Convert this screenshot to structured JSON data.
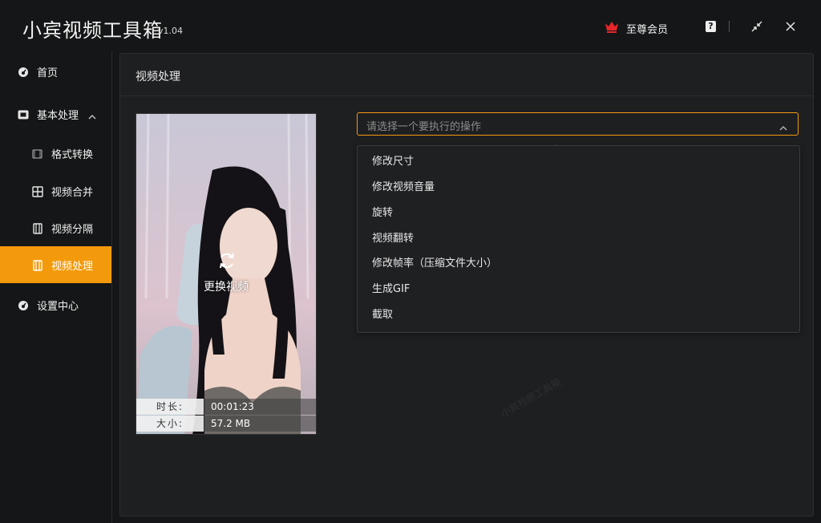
{
  "app": {
    "title": "小宾视频工具箱",
    "version": "v1.04",
    "vip_label": "至尊会员",
    "help": "?",
    "watermark": "小宾视频工具箱"
  },
  "sidebar": {
    "items": [
      {
        "label": "首页"
      },
      {
        "label": "基本处理"
      },
      {
        "label": "格式转换"
      },
      {
        "label": "视频合并"
      },
      {
        "label": "视频分隔"
      },
      {
        "label": "视频处理"
      },
      {
        "label": "设置中心"
      }
    ]
  },
  "panel": {
    "title": "视频处理"
  },
  "preview": {
    "replace_label": "更换视频",
    "duration_key": "时长:",
    "duration_value": "00:01:23",
    "size_key": "大小:",
    "size_value": "57.2 MB"
  },
  "operation_select": {
    "placeholder": "请选择一个要执行的操作",
    "options": [
      "修改尺寸",
      "修改视频音量",
      "旋转",
      "视频翻转",
      "修改帧率（压缩文件大小）",
      "生成GIF",
      "截取"
    ]
  },
  "colors": {
    "accent": "#f39a0c",
    "background": "#151617",
    "panel": "#1e1f21",
    "crown": "#e8262a"
  }
}
